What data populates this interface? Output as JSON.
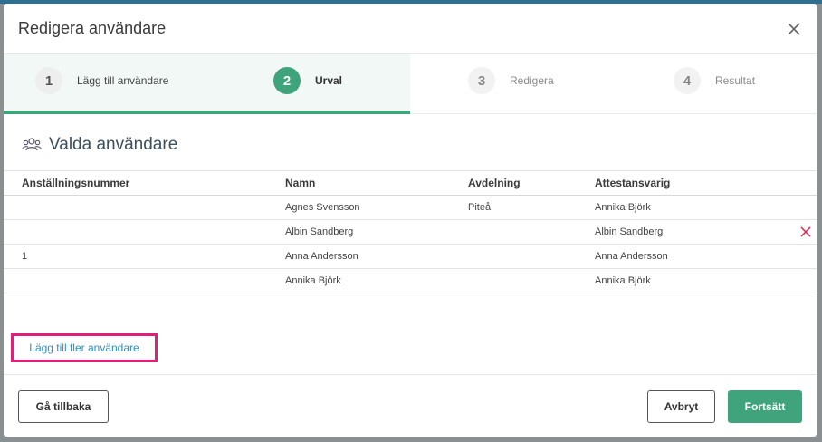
{
  "dialog": {
    "title": "Redigera användare"
  },
  "steps": [
    {
      "number": "1",
      "label": "Lägg till användare",
      "state": "done"
    },
    {
      "number": "2",
      "label": "Urval",
      "state": "active"
    },
    {
      "number": "3",
      "label": "Redigera",
      "state": "upcoming"
    },
    {
      "number": "4",
      "label": "Resultat",
      "state": "upcoming"
    }
  ],
  "section": {
    "title": "Valda användare",
    "icon": "users-icon"
  },
  "table": {
    "headers": [
      "Anställningsnummer",
      "Namn",
      "Avdelning",
      "Attestansvarig"
    ],
    "rows": [
      [
        "",
        "Agnes Svensson",
        "Piteå",
        "Annika Björk"
      ],
      [
        "",
        "Albin Sandberg",
        "",
        "Albin Sandberg"
      ],
      [
        "1",
        "Anna Andersson",
        "",
        "Anna Andersson"
      ],
      [
        "",
        "Annika Björk",
        "",
        "Annika Björk"
      ]
    ]
  },
  "add_more_link": "Lägg till fler användare",
  "footer": {
    "back": "Gå tillbaka",
    "cancel": "Avbryt",
    "continue": "Fortsätt"
  },
  "colors": {
    "accent": "#3fa37b",
    "link": "#2f8fbf",
    "remove": "#e01f50",
    "highlight": "#e01f76"
  }
}
